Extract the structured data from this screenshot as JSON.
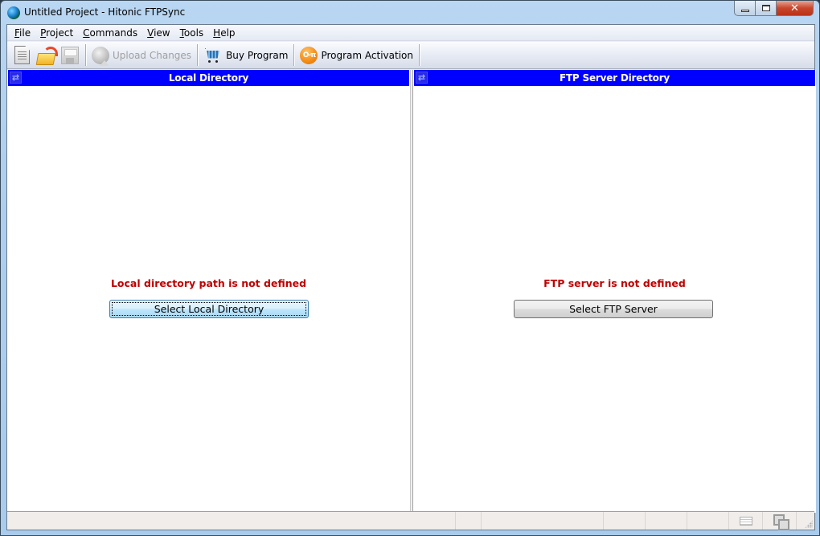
{
  "window": {
    "title": "Untitled Project - Hitonic FTPSync",
    "app_icon": "globe-icon",
    "controls": {
      "minimize": "minimize-icon",
      "maximize": "maximize-icon",
      "close": "✕"
    }
  },
  "menu": {
    "items": [
      {
        "accel": "F",
        "rest": "ile"
      },
      {
        "accel": "P",
        "rest": "roject"
      },
      {
        "accel": "C",
        "rest": "ommands"
      },
      {
        "accel": "V",
        "rest": "iew"
      },
      {
        "accel": "T",
        "rest": "ools"
      },
      {
        "accel": "H",
        "rest": "elp"
      }
    ]
  },
  "toolbar": {
    "new_icon": "new-document-icon",
    "open_icon": "open-folder-icon",
    "save_icon": "save-disk-icon",
    "upload_label": "Upload Changes",
    "upload_enabled": false,
    "buy_label": "Buy Program",
    "activation_label": "Program Activation",
    "activation_icon_text": "O‑π"
  },
  "panes": {
    "local": {
      "header": "Local Directory",
      "refresh_glyph": "⇄",
      "message": "Local directory path is not defined",
      "button": "Select Local Directory"
    },
    "ftp": {
      "header": "FTP Server Directory",
      "refresh_glyph": "⇄",
      "message": "FTP server is not defined",
      "button": "Select FTP Server"
    }
  },
  "colors": {
    "pane_header": "#0000ff",
    "warning_text": "#c00000"
  }
}
